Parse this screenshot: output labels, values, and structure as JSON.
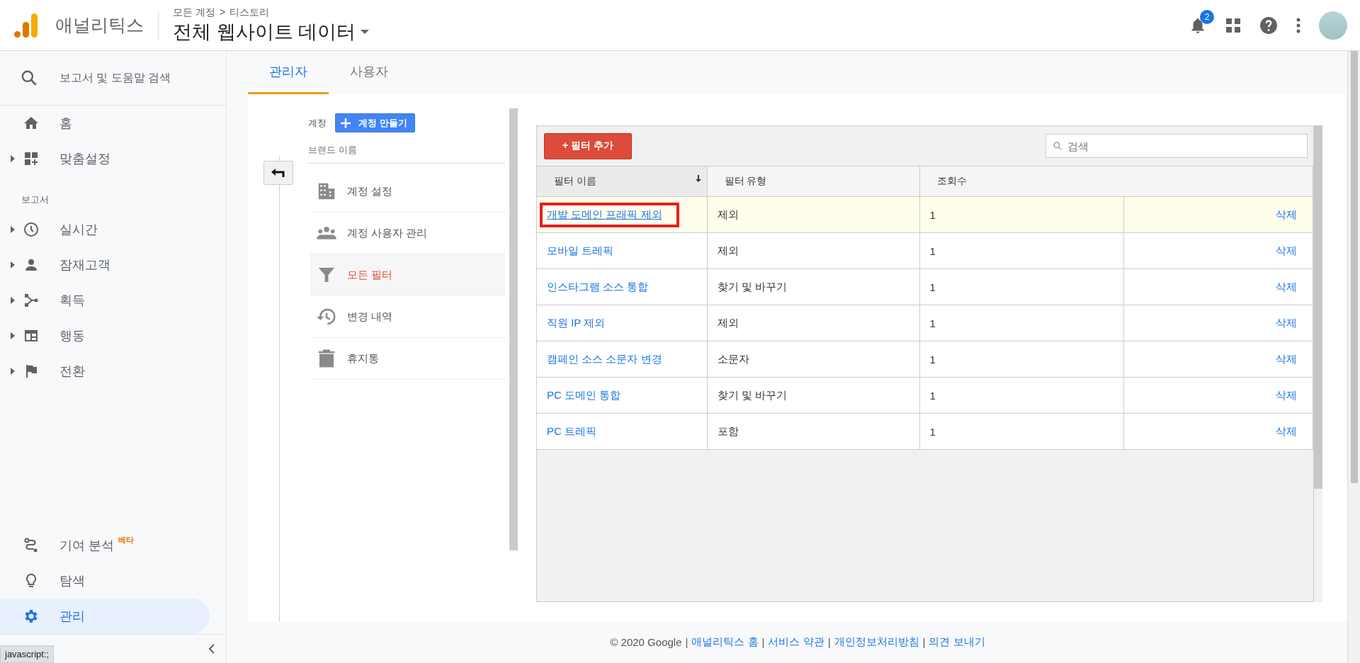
{
  "header": {
    "product": "애널리틱스",
    "breadcrumb": [
      "모든 계정",
      "티스토리"
    ],
    "breadcrumb_separator": ">",
    "view_title": "전체 웹사이트 데이터",
    "notification_count": "2"
  },
  "sidebar": {
    "search": {
      "placeholder": "보고서 및 도움말 검색"
    },
    "top_items": [
      {
        "label": "홈",
        "expandable": false,
        "selected": false
      },
      {
        "label": "맞춤설정",
        "expandable": true,
        "selected": false
      }
    ],
    "section_label": "보고서",
    "report_items": [
      {
        "label": "실시간",
        "expandable": true,
        "selected": false
      },
      {
        "label": "잠재고객",
        "expandable": true,
        "selected": false
      },
      {
        "label": "획득",
        "expandable": true,
        "selected": false
      },
      {
        "label": "행동",
        "expandable": true,
        "selected": false
      },
      {
        "label": "전환",
        "expandable": true,
        "selected": false
      }
    ],
    "bottom_items": [
      {
        "label": "기여 분석",
        "badge": "베타",
        "expandable": false,
        "selected": false
      },
      {
        "label": "탐색",
        "expandable": false,
        "selected": false
      },
      {
        "label": "관리",
        "expandable": false,
        "selected": true
      }
    ],
    "status_tooltip": "javascript:;"
  },
  "tabs": [
    {
      "label": "관리자",
      "selected": true
    },
    {
      "label": "사용자",
      "selected": false
    }
  ],
  "account": {
    "label": "계정",
    "create_button": "계정 만들기",
    "account_name": "브랜드 이름",
    "menu": [
      {
        "label": "계정 설정",
        "selected": false
      },
      {
        "label": "계정 사용자 관리",
        "selected": false
      },
      {
        "label": "모든 필터",
        "selected": true
      },
      {
        "label": "변경 내역",
        "selected": false
      },
      {
        "label": "휴지통",
        "selected": false
      }
    ]
  },
  "filters": {
    "add_button": "+ 필터 추가",
    "search": {
      "placeholder": "검색"
    },
    "columns": [
      "필터 이름",
      "필터 유형",
      "조회수"
    ],
    "rows": [
      {
        "name": "개발 도메인 프래픽 제외",
        "type": "제외",
        "views": "1",
        "action": "삭제",
        "highlighted": true,
        "marked": true
      },
      {
        "name": "모바일 트레픽",
        "type": "제외",
        "views": "1",
        "action": "삭제",
        "highlighted": false,
        "marked": false
      },
      {
        "name": "인스타그램 소스 통합",
        "type": "찾기 및 바꾸기",
        "views": "1",
        "action": "삭제",
        "highlighted": false,
        "marked": false
      },
      {
        "name": "직원 IP 제외",
        "type": "제외",
        "views": "1",
        "action": "삭제",
        "highlighted": false,
        "marked": false
      },
      {
        "name": "캠페인 소스 소문자 변경",
        "type": "소문자",
        "views": "1",
        "action": "삭제",
        "highlighted": false,
        "marked": false
      },
      {
        "name": "PC 도메인 통합",
        "type": "찾기 및 바꾸기",
        "views": "1",
        "action": "삭제",
        "highlighted": false,
        "marked": false
      },
      {
        "name": "PC 트레픽",
        "type": "포함",
        "views": "1",
        "action": "삭제",
        "highlighted": false,
        "marked": false
      }
    ]
  },
  "footer": {
    "copyright": "© 2020 Google",
    "separator": "|",
    "links": [
      "애널리틱스 홈",
      "서비스 약관",
      "개인정보처리방침",
      "의견 보내기"
    ]
  }
}
